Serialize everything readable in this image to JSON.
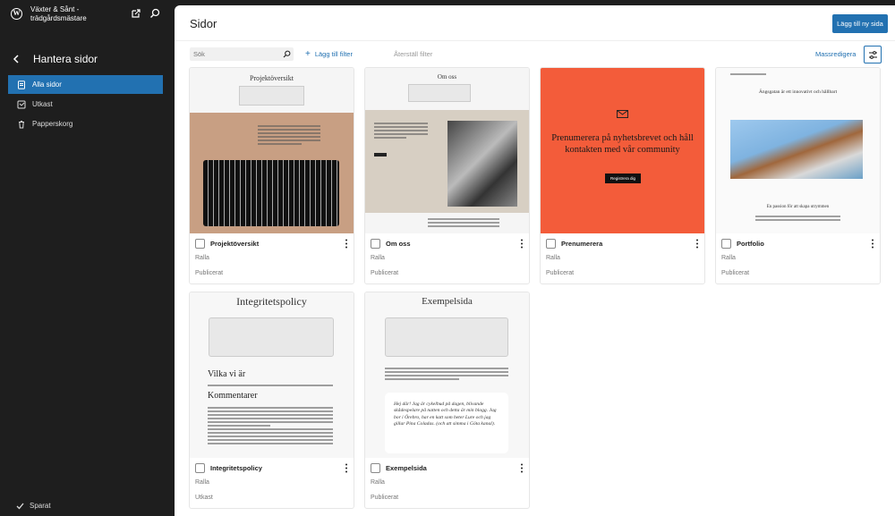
{
  "site": {
    "title": "Växter & Sånt - trädgårdsmästare"
  },
  "sidebar": {
    "section_title": "Hantera sidor",
    "items": [
      {
        "label": "Alla sidor",
        "icon": "pages-icon",
        "active": true
      },
      {
        "label": "Utkast",
        "icon": "drafts-icon",
        "active": false
      },
      {
        "label": "Papperskorg",
        "icon": "trash-icon",
        "active": false
      }
    ],
    "saved_label": "Sparat"
  },
  "header": {
    "title": "Sidor",
    "add_button": "Lägg till ny sida"
  },
  "filters": {
    "search_placeholder": "Sök",
    "add_filter": "Lägg till filter",
    "reset_filter": "Återställ filter",
    "bulk_edit": "Massredigera"
  },
  "pages": [
    {
      "title": "Projektöversikt",
      "author": "Ralla",
      "status": "Publicerat",
      "thumb_heading": "Projektöversikt"
    },
    {
      "title": "Om oss",
      "author": "Ralla",
      "status": "Publicerat",
      "thumb_heading": "Om oss"
    },
    {
      "title": "Prenumerera",
      "author": "Ralla",
      "status": "Publicerat",
      "thumb_heading": "Prenumerera på nyhetsbrevet och håll kontakten med vår community",
      "thumb_button": "Registrera dig"
    },
    {
      "title": "Portfolio",
      "author": "Ralla",
      "status": "Publicerat",
      "thumb_heading": "Ängsgatan är ett innovativt och hållbart",
      "thumb_sub": "En passion för att skapa utrymmen"
    },
    {
      "title": "Integritetspolicy",
      "author": "Ralla",
      "status": "Utkast",
      "thumb_heading": "Integritetspolicy",
      "thumb_h2": "Vilka vi är",
      "thumb_h3": "Kommentarer"
    },
    {
      "title": "Exempelsida",
      "author": "Ralla",
      "status": "Publicerat",
      "thumb_heading": "Exempelsida",
      "thumb_quote": "Hej där! Jag är cykelbud på dagen, blivande skådespelare på natten och detta är min blogg. Jag bor i Örebro, har en katt som heter Lure och jag gillar Pina Coladas. (och att simma i Göta kanal)."
    }
  ],
  "colors": {
    "accent": "#2271b1",
    "subscribe_bg": "#f35c3a",
    "sidebar_bg": "#1e1e1e"
  }
}
